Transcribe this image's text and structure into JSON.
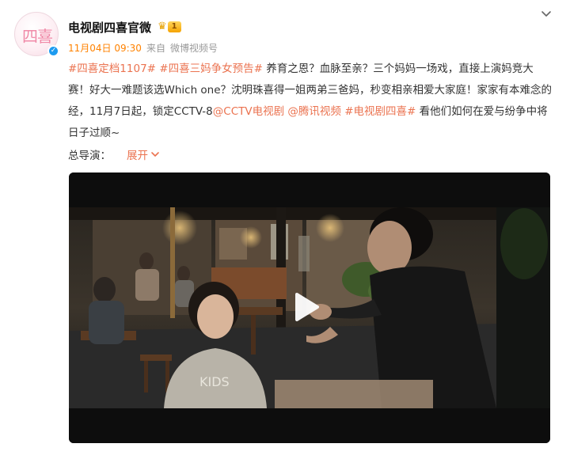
{
  "account": {
    "avatar_text": "四喜",
    "name": "电视剧四喜官微",
    "vip_level": "1"
  },
  "meta": {
    "time": "11月04日 09:30",
    "source_prefix": "来自",
    "source": "微博视频号"
  },
  "post": {
    "tag1": "#四喜定档1107#",
    "tag2": "#四喜三妈争女预告#",
    "text1": " 养育之恩？血脉至亲？三个妈妈一场戏，直接上演妈竞大赛！好大一难题该选Which one？沈明珠喜得一姐两弟三爸妈，秒变相亲相爱大家庭！家家有本难念的经，11月7日起，锁定CCTV-8",
    "mention1": "@CCTV电视剧",
    "space": " ",
    "mention2": "@腾讯视频",
    "tag3": " #电视剧四喜#",
    "text2": " 看他们如何在爱与纷争中将日子过顺~"
  },
  "director": {
    "label": "总导演：",
    "expand_label": "展开"
  },
  "video": {
    "shirt_text": "KIDS"
  },
  "icons": {
    "more": "chevron-down-icon",
    "expand": "chevron-down-icon",
    "play": "play-icon",
    "verified": "verified-icon",
    "vip": "crown-icon"
  },
  "colors": {
    "link": "#eb7350",
    "time": "#ff8200",
    "verified": "#1d9bf0"
  }
}
